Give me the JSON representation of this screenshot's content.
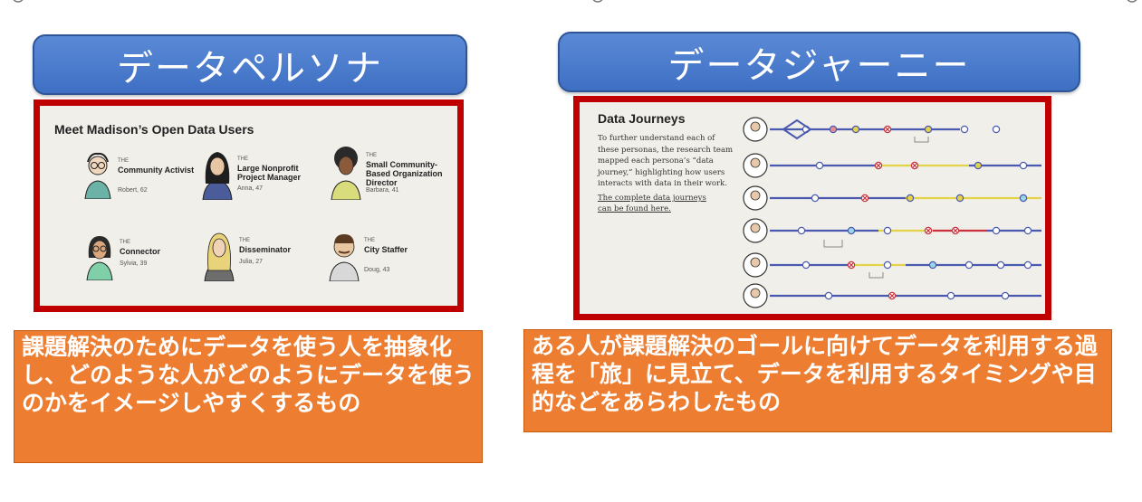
{
  "left": {
    "title": "データペルソナ",
    "panel_title": "Meet Madison’s Open Data Users",
    "the_label": "THE",
    "personas": [
      {
        "name": "Community Activist",
        "sub": "Robert, 62"
      },
      {
        "name": "Large Nonprofit Project Manager",
        "sub": "Anna, 47"
      },
      {
        "name": "Small Community-Based Organization Director",
        "sub": "Barbara, 41"
      },
      {
        "name": "Connector",
        "sub": "Sylvia, 39"
      },
      {
        "name": "Disseminator",
        "sub": "Julia, 27"
      },
      {
        "name": "City Staffer",
        "sub": "Doug, 43"
      }
    ],
    "note": "課題解決のためにデータを使う人を抽象化し、どのような人がどのようにデータを使うのかをイメージしやすくするもの"
  },
  "right": {
    "title": "データジャーニー",
    "panel_title": "Data Journeys",
    "panel_body": "To further understand each of these personas, the research team mapped each persona’s “data journey,” highlighting how users interacts with data in their work.",
    "panel_link": "The complete data journeys can be found here.",
    "note": "ある人が課題解決のゴールに向けてデータを利用する過程を「旅」に見立て、データを利用するタイミングや目的などをあらわしたもの"
  },
  "colors": {
    "pill": "#4472c4",
    "frame": "#c00000",
    "note": "#ed7d31",
    "track": "#4a5ab0",
    "yellow": "#e4d24a",
    "red": "#c8323c",
    "cyan": "#9ad6e8"
  }
}
